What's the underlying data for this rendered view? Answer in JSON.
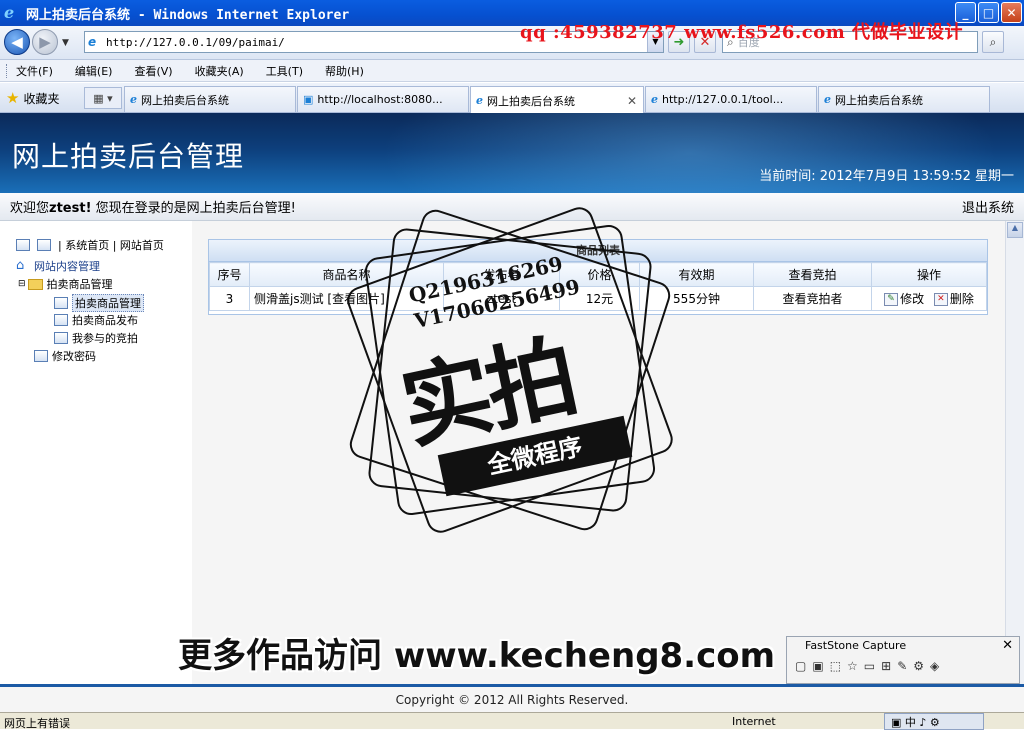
{
  "window": {
    "title": "网上拍卖后台系统 - Windows Internet Explorer",
    "minimize": "_",
    "maximize": "□",
    "close": "✕"
  },
  "nav": {
    "url": "http://127.0.0.1/09/paimai/",
    "search_placeholder": "百度",
    "overlay_ad": "qq :459382737 www.fs526.com 代做毕业设计"
  },
  "menu": [
    "文件(F)",
    "编辑(E)",
    "查看(V)",
    "收藏夹(A)",
    "工具(T)",
    "帮助(H)"
  ],
  "favorites_label": "收藏夹",
  "tabs": [
    {
      "label": "网上拍卖后台系统"
    },
    {
      "label": "http://localhost:8080..."
    },
    {
      "label": "网上拍卖后台系统"
    },
    {
      "label": "http://127.0.0.1/tool..."
    },
    {
      "label": "网上拍卖后台系统"
    }
  ],
  "header": {
    "title": "网上拍卖后台管理",
    "time": "当前时间:  2012年7月9日 13:59:52 星期一"
  },
  "welcome": {
    "prefix": "欢迎您",
    "user": "ztest!",
    "suffix": " 您现在登录的是网上拍卖后台管理!",
    "logout": "退出系统"
  },
  "sidebar": {
    "top_links": "| 系统首页 | 网站首页",
    "root": "网站内容管理",
    "group": "拍卖商品管理",
    "items": [
      "拍卖商品管理",
      "拍卖商品发布",
      "我参与的竞拍"
    ],
    "password": "修改密码"
  },
  "panel": {
    "title": "商品列表",
    "columns": [
      "序号",
      "商品名称",
      "发布者",
      "价格",
      "有效期",
      "查看竞拍",
      "操作"
    ],
    "rows": [
      {
        "id": "3",
        "name": "侧滑盖js测试 [查看图片]",
        "publisher": "ztest",
        "price": "12元",
        "period": "555分钟",
        "bids": "查看竞拍者",
        "edit": "修改",
        "delete": "删除"
      }
    ]
  },
  "watermark": {
    "qq": "Q2196316269",
    "vx": "V17060256499",
    "big": "实拍",
    "ribbon": "全微程序",
    "bottom": "更多作品访问 www.kecheng8.com"
  },
  "faststone": {
    "title": "FastStone Capture"
  },
  "footer": {
    "copyright": "Copyright © 2012 All Rights Reserved."
  },
  "status": {
    "text": "网页上有错误",
    "zone": "Internet"
  }
}
